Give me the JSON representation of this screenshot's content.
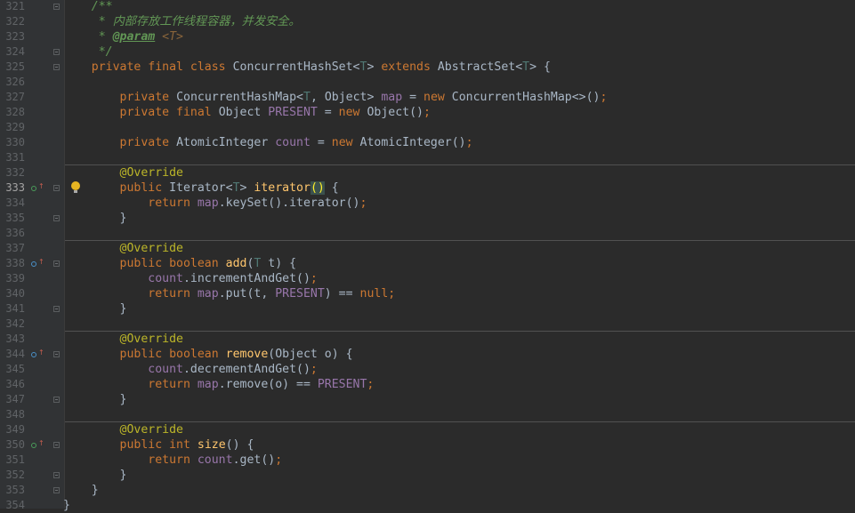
{
  "lines": [
    {
      "n": "321",
      "tokens": [
        {
          "t": "    ",
          "c": ""
        },
        {
          "t": "/**",
          "c": "cm"
        }
      ]
    },
    {
      "n": "322",
      "tokens": [
        {
          "t": "     * 内部存放工作线程容器，并发安全。",
          "c": "cm"
        }
      ]
    },
    {
      "n": "323",
      "tokens": [
        {
          "t": "     * ",
          "c": "cm"
        },
        {
          "t": "@param",
          "c": "cmtag"
        },
        {
          "t": " ",
          "c": "cm"
        },
        {
          "t": "<T>",
          "c": "cmref"
        }
      ]
    },
    {
      "n": "324",
      "tokens": [
        {
          "t": "     */",
          "c": "cm"
        }
      ]
    },
    {
      "n": "325",
      "tokens": [
        {
          "t": "    ",
          "c": ""
        },
        {
          "t": "private final class ",
          "c": "kw"
        },
        {
          "t": "ConcurrentHashSet<",
          "c": ""
        },
        {
          "t": "T",
          "c": "tp"
        },
        {
          "t": "> ",
          "c": ""
        },
        {
          "t": "extends ",
          "c": "kw"
        },
        {
          "t": "AbstractSet<",
          "c": ""
        },
        {
          "t": "T",
          "c": "tp"
        },
        {
          "t": "> {",
          "c": ""
        }
      ]
    },
    {
      "n": "326",
      "tokens": []
    },
    {
      "n": "327",
      "tokens": [
        {
          "t": "        ",
          "c": ""
        },
        {
          "t": "private ",
          "c": "kw"
        },
        {
          "t": "ConcurrentHashMap<",
          "c": ""
        },
        {
          "t": "T",
          "c": "tp"
        },
        {
          "t": ", Object> ",
          "c": ""
        },
        {
          "t": "map",
          "c": "fld"
        },
        {
          "t": " = ",
          "c": ""
        },
        {
          "t": "new ",
          "c": "kw"
        },
        {
          "t": "ConcurrentHashMap<>()",
          "c": ""
        },
        {
          "t": ";",
          "c": "kw"
        }
      ]
    },
    {
      "n": "328",
      "tokens": [
        {
          "t": "        ",
          "c": ""
        },
        {
          "t": "private final ",
          "c": "kw"
        },
        {
          "t": "Object ",
          "c": ""
        },
        {
          "t": "PRESENT",
          "c": "fld"
        },
        {
          "t": " = ",
          "c": ""
        },
        {
          "t": "new ",
          "c": "kw"
        },
        {
          "t": "Object()",
          "c": ""
        },
        {
          "t": ";",
          "c": "kw"
        }
      ]
    },
    {
      "n": "329",
      "tokens": []
    },
    {
      "n": "330",
      "tokens": [
        {
          "t": "        ",
          "c": ""
        },
        {
          "t": "private ",
          "c": "kw"
        },
        {
          "t": "AtomicInteger ",
          "c": ""
        },
        {
          "t": "count",
          "c": "fld"
        },
        {
          "t": " = ",
          "c": ""
        },
        {
          "t": "new ",
          "c": "kw"
        },
        {
          "t": "AtomicInteger()",
          "c": ""
        },
        {
          "t": ";",
          "c": "kw"
        }
      ]
    },
    {
      "n": "331",
      "tokens": []
    },
    {
      "n": "332",
      "tokens": [
        {
          "t": "        ",
          "c": ""
        },
        {
          "t": "@Override",
          "c": "an"
        }
      ]
    },
    {
      "n": "333",
      "tokens": [
        {
          "t": "        ",
          "c": ""
        },
        {
          "t": "public ",
          "c": "kw"
        },
        {
          "t": "Iterator<",
          "c": ""
        },
        {
          "t": "T",
          "c": "tp"
        },
        {
          "t": "> ",
          "c": ""
        },
        {
          "t": "iterator",
          "c": "fn"
        },
        {
          "t": "(",
          "c": "br"
        },
        {
          "t": ")",
          "c": "br"
        },
        {
          "t": " {",
          "c": ""
        }
      ]
    },
    {
      "n": "334",
      "tokens": [
        {
          "t": "            ",
          "c": ""
        },
        {
          "t": "return ",
          "c": "kw"
        },
        {
          "t": "map",
          "c": "fld"
        },
        {
          "t": ".keySet().iterator()",
          "c": ""
        },
        {
          "t": ";",
          "c": "kw"
        }
      ]
    },
    {
      "n": "335",
      "tokens": [
        {
          "t": "        }",
          "c": ""
        }
      ]
    },
    {
      "n": "336",
      "tokens": []
    },
    {
      "n": "337",
      "tokens": [
        {
          "t": "        ",
          "c": ""
        },
        {
          "t": "@Override",
          "c": "an"
        }
      ]
    },
    {
      "n": "338",
      "tokens": [
        {
          "t": "        ",
          "c": ""
        },
        {
          "t": "public boolean ",
          "c": "kw"
        },
        {
          "t": "add",
          "c": "fn"
        },
        {
          "t": "(",
          "c": ""
        },
        {
          "t": "T",
          "c": "tp"
        },
        {
          "t": " t) {",
          "c": ""
        }
      ]
    },
    {
      "n": "339",
      "tokens": [
        {
          "t": "            ",
          "c": ""
        },
        {
          "t": "count",
          "c": "fld"
        },
        {
          "t": ".incrementAndGet()",
          "c": ""
        },
        {
          "t": ";",
          "c": "kw"
        }
      ]
    },
    {
      "n": "340",
      "tokens": [
        {
          "t": "            ",
          "c": ""
        },
        {
          "t": "return ",
          "c": "kw"
        },
        {
          "t": "map",
          "c": "fld"
        },
        {
          "t": ".put(t, ",
          "c": ""
        },
        {
          "t": "PRESENT",
          "c": "fld"
        },
        {
          "t": ") == ",
          "c": ""
        },
        {
          "t": "null;",
          "c": "kw"
        }
      ]
    },
    {
      "n": "341",
      "tokens": [
        {
          "t": "        }",
          "c": ""
        }
      ]
    },
    {
      "n": "342",
      "tokens": []
    },
    {
      "n": "343",
      "tokens": [
        {
          "t": "        ",
          "c": ""
        },
        {
          "t": "@Override",
          "c": "an"
        }
      ]
    },
    {
      "n": "344",
      "tokens": [
        {
          "t": "        ",
          "c": ""
        },
        {
          "t": "public boolean ",
          "c": "kw"
        },
        {
          "t": "remove",
          "c": "fn"
        },
        {
          "t": "(Object o) {",
          "c": ""
        }
      ]
    },
    {
      "n": "345",
      "tokens": [
        {
          "t": "            ",
          "c": ""
        },
        {
          "t": "count",
          "c": "fld"
        },
        {
          "t": ".decrementAndGet()",
          "c": ""
        },
        {
          "t": ";",
          "c": "kw"
        }
      ]
    },
    {
      "n": "346",
      "tokens": [
        {
          "t": "            ",
          "c": ""
        },
        {
          "t": "return ",
          "c": "kw"
        },
        {
          "t": "map",
          "c": "fld"
        },
        {
          "t": ".remove(o) == ",
          "c": ""
        },
        {
          "t": "PRESENT",
          "c": "fld"
        },
        {
          "t": ";",
          "c": "kw"
        }
      ]
    },
    {
      "n": "347",
      "tokens": [
        {
          "t": "        }",
          "c": ""
        }
      ]
    },
    {
      "n": "348",
      "tokens": []
    },
    {
      "n": "349",
      "tokens": [
        {
          "t": "        ",
          "c": ""
        },
        {
          "t": "@Override",
          "c": "an"
        }
      ]
    },
    {
      "n": "350",
      "tokens": [
        {
          "t": "        ",
          "c": ""
        },
        {
          "t": "public int ",
          "c": "kw"
        },
        {
          "t": "size",
          "c": "fn"
        },
        {
          "t": "() {",
          "c": ""
        }
      ]
    },
    {
      "n": "351",
      "tokens": [
        {
          "t": "            ",
          "c": ""
        },
        {
          "t": "return ",
          "c": "kw"
        },
        {
          "t": "count",
          "c": "fld"
        },
        {
          "t": ".get()",
          "c": ""
        },
        {
          "t": ";",
          "c": "kw"
        }
      ]
    },
    {
      "n": "352",
      "tokens": [
        {
          "t": "        }",
          "c": ""
        }
      ]
    },
    {
      "n": "353",
      "tokens": [
        {
          "t": "    }",
          "c": ""
        }
      ]
    },
    {
      "n": "354",
      "tokens": [
        {
          "t": "}",
          "c": ""
        }
      ]
    }
  ],
  "current_line": "333",
  "override_markers": [
    {
      "line": "333",
      "icon": "override-icon",
      "color": "#4a9c5a"
    },
    {
      "line": "338",
      "icon": "implements-icon",
      "color": "#4a90c8"
    },
    {
      "line": "344",
      "icon": "implements-icon",
      "color": "#4a90c8"
    },
    {
      "line": "350",
      "icon": "override-icon",
      "color": "#4a9c5a"
    }
  ],
  "intention_bulb": {
    "line": "333",
    "icon": "lightbulb-icon",
    "color": "#e6b422"
  },
  "method_separators_before": [
    "332",
    "337",
    "343",
    "349"
  ],
  "fold_markers": [
    "321",
    "324",
    "325",
    "333",
    "335",
    "338",
    "341",
    "344",
    "347",
    "350",
    "352",
    "353"
  ],
  "theme": {
    "background": "#2b2b2b",
    "gutter": "#313335",
    "keyword": "#cc7832",
    "comment": "#629755",
    "field": "#9876aa",
    "method": "#ffc66d",
    "annotation": "#bbb529",
    "type_param": "#507874",
    "text": "#a9b7c6"
  }
}
